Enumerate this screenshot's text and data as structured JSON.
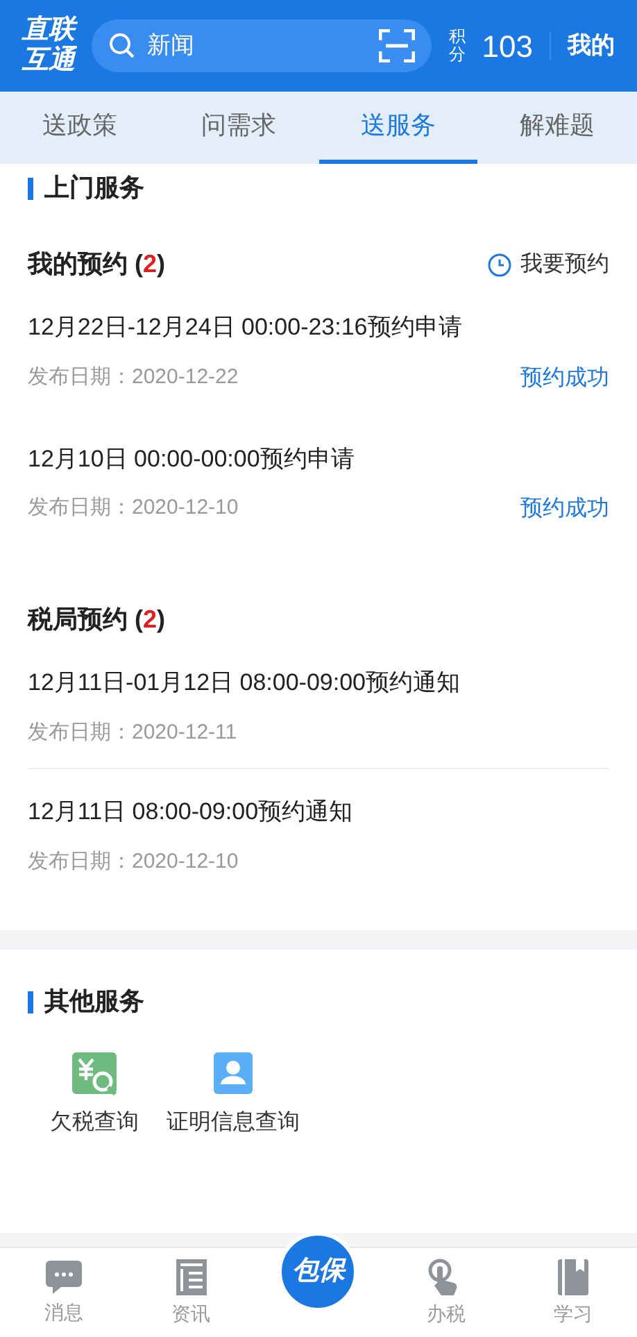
{
  "header": {
    "logo": [
      "直联",
      "互通"
    ],
    "search": {
      "placeholder": "新闻"
    },
    "points_label": "积分",
    "points": "103",
    "profile": "我的"
  },
  "tabs": [
    {
      "label": "送政策",
      "selected": false
    },
    {
      "label": "问需求",
      "selected": false
    },
    {
      "label": "送服务",
      "selected": true
    },
    {
      "label": "解难题",
      "selected": false
    }
  ],
  "door_service": {
    "title": "上门服务",
    "groups": [
      {
        "title": "我的预约 (**2**)",
        "action": "我要预约",
        "divided": false,
        "items": [
          {
            "title": "12月22日-12月24日 00:00-23:16预约申请",
            "date": "发布日期：2020-12-22",
            "status": "预约成功"
          },
          {
            "title": "12月10日 00:00-00:00预约申请",
            "date": "发布日期：2020-12-10",
            "status": "预约成功"
          }
        ]
      },
      {
        "title": "税局预约 (**2**)",
        "divided": true,
        "items": [
          {
            "title": "12月11日-01月12日 08:00-09:00预约通知",
            "date": "发布日期：2020-12-11"
          },
          {
            "title": "12月11日 08:00-09:00预约通知",
            "date": "发布日期：2020-12-10"
          }
        ]
      }
    ]
  },
  "other_services": {
    "title": "其他服务",
    "items": [
      {
        "label": "欠税查询",
        "kind": "tax"
      },
      {
        "label": "证明信息查询",
        "kind": "certificate"
      }
    ]
  },
  "bottom_nav": [
    {
      "label": "消息",
      "kind": "message"
    },
    {
      "label": "资讯",
      "kind": "news"
    },
    {
      "label": "包保",
      "kind": "center"
    },
    {
      "label": "办税",
      "kind": "tap"
    },
    {
      "label": "学习",
      "kind": "book"
    }
  ]
}
